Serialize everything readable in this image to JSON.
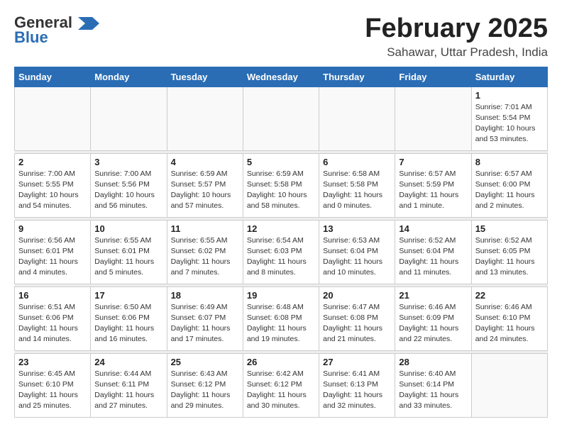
{
  "header": {
    "logo_general": "General",
    "logo_blue": "Blue",
    "title": "February 2025",
    "subtitle": "Sahawar, Uttar Pradesh, India"
  },
  "weekdays": [
    "Sunday",
    "Monday",
    "Tuesday",
    "Wednesday",
    "Thursday",
    "Friday",
    "Saturday"
  ],
  "weeks": [
    [
      {
        "day": "",
        "info": ""
      },
      {
        "day": "",
        "info": ""
      },
      {
        "day": "",
        "info": ""
      },
      {
        "day": "",
        "info": ""
      },
      {
        "day": "",
        "info": ""
      },
      {
        "day": "",
        "info": ""
      },
      {
        "day": "1",
        "info": "Sunrise: 7:01 AM\nSunset: 5:54 PM\nDaylight: 10 hours\nand 53 minutes."
      }
    ],
    [
      {
        "day": "2",
        "info": "Sunrise: 7:00 AM\nSunset: 5:55 PM\nDaylight: 10 hours\nand 54 minutes."
      },
      {
        "day": "3",
        "info": "Sunrise: 7:00 AM\nSunset: 5:56 PM\nDaylight: 10 hours\nand 56 minutes."
      },
      {
        "day": "4",
        "info": "Sunrise: 6:59 AM\nSunset: 5:57 PM\nDaylight: 10 hours\nand 57 minutes."
      },
      {
        "day": "5",
        "info": "Sunrise: 6:59 AM\nSunset: 5:58 PM\nDaylight: 10 hours\nand 58 minutes."
      },
      {
        "day": "6",
        "info": "Sunrise: 6:58 AM\nSunset: 5:58 PM\nDaylight: 11 hours\nand 0 minutes."
      },
      {
        "day": "7",
        "info": "Sunrise: 6:57 AM\nSunset: 5:59 PM\nDaylight: 11 hours\nand 1 minute."
      },
      {
        "day": "8",
        "info": "Sunrise: 6:57 AM\nSunset: 6:00 PM\nDaylight: 11 hours\nand 2 minutes."
      }
    ],
    [
      {
        "day": "9",
        "info": "Sunrise: 6:56 AM\nSunset: 6:01 PM\nDaylight: 11 hours\nand 4 minutes."
      },
      {
        "day": "10",
        "info": "Sunrise: 6:55 AM\nSunset: 6:01 PM\nDaylight: 11 hours\nand 5 minutes."
      },
      {
        "day": "11",
        "info": "Sunrise: 6:55 AM\nSunset: 6:02 PM\nDaylight: 11 hours\nand 7 minutes."
      },
      {
        "day": "12",
        "info": "Sunrise: 6:54 AM\nSunset: 6:03 PM\nDaylight: 11 hours\nand 8 minutes."
      },
      {
        "day": "13",
        "info": "Sunrise: 6:53 AM\nSunset: 6:04 PM\nDaylight: 11 hours\nand 10 minutes."
      },
      {
        "day": "14",
        "info": "Sunrise: 6:52 AM\nSunset: 6:04 PM\nDaylight: 11 hours\nand 11 minutes."
      },
      {
        "day": "15",
        "info": "Sunrise: 6:52 AM\nSunset: 6:05 PM\nDaylight: 11 hours\nand 13 minutes."
      }
    ],
    [
      {
        "day": "16",
        "info": "Sunrise: 6:51 AM\nSunset: 6:06 PM\nDaylight: 11 hours\nand 14 minutes."
      },
      {
        "day": "17",
        "info": "Sunrise: 6:50 AM\nSunset: 6:06 PM\nDaylight: 11 hours\nand 16 minutes."
      },
      {
        "day": "18",
        "info": "Sunrise: 6:49 AM\nSunset: 6:07 PM\nDaylight: 11 hours\nand 17 minutes."
      },
      {
        "day": "19",
        "info": "Sunrise: 6:48 AM\nSunset: 6:08 PM\nDaylight: 11 hours\nand 19 minutes."
      },
      {
        "day": "20",
        "info": "Sunrise: 6:47 AM\nSunset: 6:08 PM\nDaylight: 11 hours\nand 21 minutes."
      },
      {
        "day": "21",
        "info": "Sunrise: 6:46 AM\nSunset: 6:09 PM\nDaylight: 11 hours\nand 22 minutes."
      },
      {
        "day": "22",
        "info": "Sunrise: 6:46 AM\nSunset: 6:10 PM\nDaylight: 11 hours\nand 24 minutes."
      }
    ],
    [
      {
        "day": "23",
        "info": "Sunrise: 6:45 AM\nSunset: 6:10 PM\nDaylight: 11 hours\nand 25 minutes."
      },
      {
        "day": "24",
        "info": "Sunrise: 6:44 AM\nSunset: 6:11 PM\nDaylight: 11 hours\nand 27 minutes."
      },
      {
        "day": "25",
        "info": "Sunrise: 6:43 AM\nSunset: 6:12 PM\nDaylight: 11 hours\nand 29 minutes."
      },
      {
        "day": "26",
        "info": "Sunrise: 6:42 AM\nSunset: 6:12 PM\nDaylight: 11 hours\nand 30 minutes."
      },
      {
        "day": "27",
        "info": "Sunrise: 6:41 AM\nSunset: 6:13 PM\nDaylight: 11 hours\nand 32 minutes."
      },
      {
        "day": "28",
        "info": "Sunrise: 6:40 AM\nSunset: 6:14 PM\nDaylight: 11 hours\nand 33 minutes."
      },
      {
        "day": "",
        "info": ""
      }
    ]
  ]
}
